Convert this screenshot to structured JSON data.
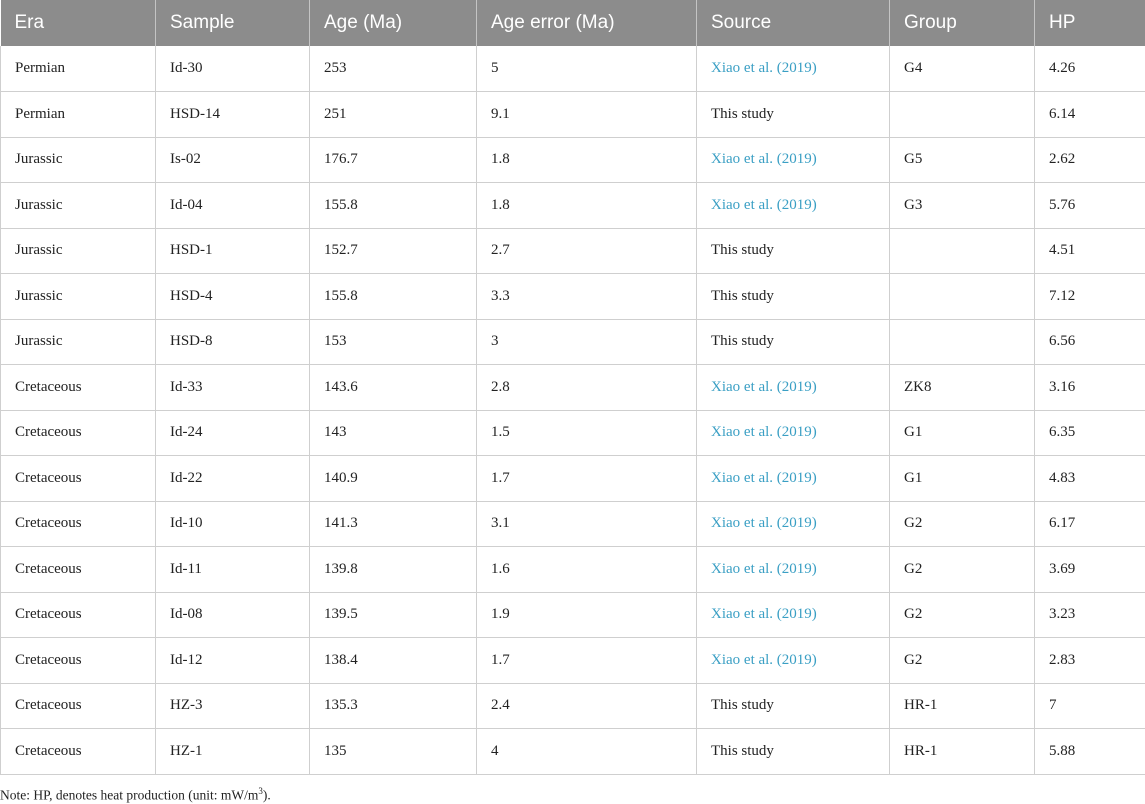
{
  "table": {
    "headers": [
      "Era",
      "Sample",
      "Age (Ma)",
      "Age error (Ma)",
      "Source",
      "Group",
      "HP"
    ],
    "rows": [
      {
        "era": "Permian",
        "sample": "Id-30",
        "age": "253",
        "age_error": "5",
        "source": "Xiao et al. (2019)",
        "source_is_link": true,
        "group": "G4",
        "hp": "4.26"
      },
      {
        "era": "Permian",
        "sample": "HSD-14",
        "age": "251",
        "age_error": "9.1",
        "source": "This study",
        "source_is_link": false,
        "group": "",
        "hp": "6.14"
      },
      {
        "era": "Jurassic",
        "sample": "Is-02",
        "age": "176.7",
        "age_error": "1.8",
        "source": "Xiao et al. (2019)",
        "source_is_link": true,
        "group": "G5",
        "hp": "2.62"
      },
      {
        "era": "Jurassic",
        "sample": "Id-04",
        "age": "155.8",
        "age_error": "1.8",
        "source": "Xiao et al. (2019)",
        "source_is_link": true,
        "group": "G3",
        "hp": "5.76"
      },
      {
        "era": "Jurassic",
        "sample": "HSD-1",
        "age": "152.7",
        "age_error": "2.7",
        "source": "This study",
        "source_is_link": false,
        "group": "",
        "hp": "4.51"
      },
      {
        "era": "Jurassic",
        "sample": "HSD-4",
        "age": "155.8",
        "age_error": "3.3",
        "source": "This study",
        "source_is_link": false,
        "group": "",
        "hp": "7.12"
      },
      {
        "era": "Jurassic",
        "sample": "HSD-8",
        "age": "153",
        "age_error": "3",
        "source": "This study",
        "source_is_link": false,
        "group": "",
        "hp": "6.56"
      },
      {
        "era": "Cretaceous",
        "sample": "Id-33",
        "age": "143.6",
        "age_error": "2.8",
        "source": "Xiao et al. (2019)",
        "source_is_link": true,
        "group": "ZK8",
        "hp": "3.16"
      },
      {
        "era": "Cretaceous",
        "sample": "Id-24",
        "age": "143",
        "age_error": "1.5",
        "source": "Xiao et al. (2019)",
        "source_is_link": true,
        "group": "G1",
        "hp": "6.35"
      },
      {
        "era": "Cretaceous",
        "sample": "Id-22",
        "age": "140.9",
        "age_error": "1.7",
        "source": "Xiao et al. (2019)",
        "source_is_link": true,
        "group": "G1",
        "hp": "4.83"
      },
      {
        "era": "Cretaceous",
        "sample": "Id-10",
        "age": "141.3",
        "age_error": "3.1",
        "source": "Xiao et al. (2019)",
        "source_is_link": true,
        "group": "G2",
        "hp": "6.17"
      },
      {
        "era": "Cretaceous",
        "sample": "Id-11",
        "age": "139.8",
        "age_error": "1.6",
        "source": "Xiao et al. (2019)",
        "source_is_link": true,
        "group": "G2",
        "hp": "3.69"
      },
      {
        "era": "Cretaceous",
        "sample": "Id-08",
        "age": "139.5",
        "age_error": "1.9",
        "source": "Xiao et al. (2019)",
        "source_is_link": true,
        "group": "G2",
        "hp": "3.23"
      },
      {
        "era": "Cretaceous",
        "sample": "Id-12",
        "age": "138.4",
        "age_error": "1.7",
        "source": "Xiao et al. (2019)",
        "source_is_link": true,
        "group": "G2",
        "hp": "2.83"
      },
      {
        "era": "Cretaceous",
        "sample": "HZ-3",
        "age": "135.3",
        "age_error": "2.4",
        "source": "This study",
        "source_is_link": false,
        "group": "HR-1",
        "hp": "7"
      },
      {
        "era": "Cretaceous",
        "sample": "HZ-1",
        "age": "135",
        "age_error": "4",
        "source": "This study",
        "source_is_link": false,
        "group": "HR-1",
        "hp": "5.88"
      }
    ]
  },
  "footnote": {
    "text": "Note: HP, denotes heat production (unit: mW/m",
    "superscript": "3",
    "suffix": ")."
  },
  "colors": {
    "header_background": "#8c8c8c",
    "header_text": "#ffffff",
    "link_text": "#3a9fc4",
    "grid_line": "#cfcfcf"
  }
}
